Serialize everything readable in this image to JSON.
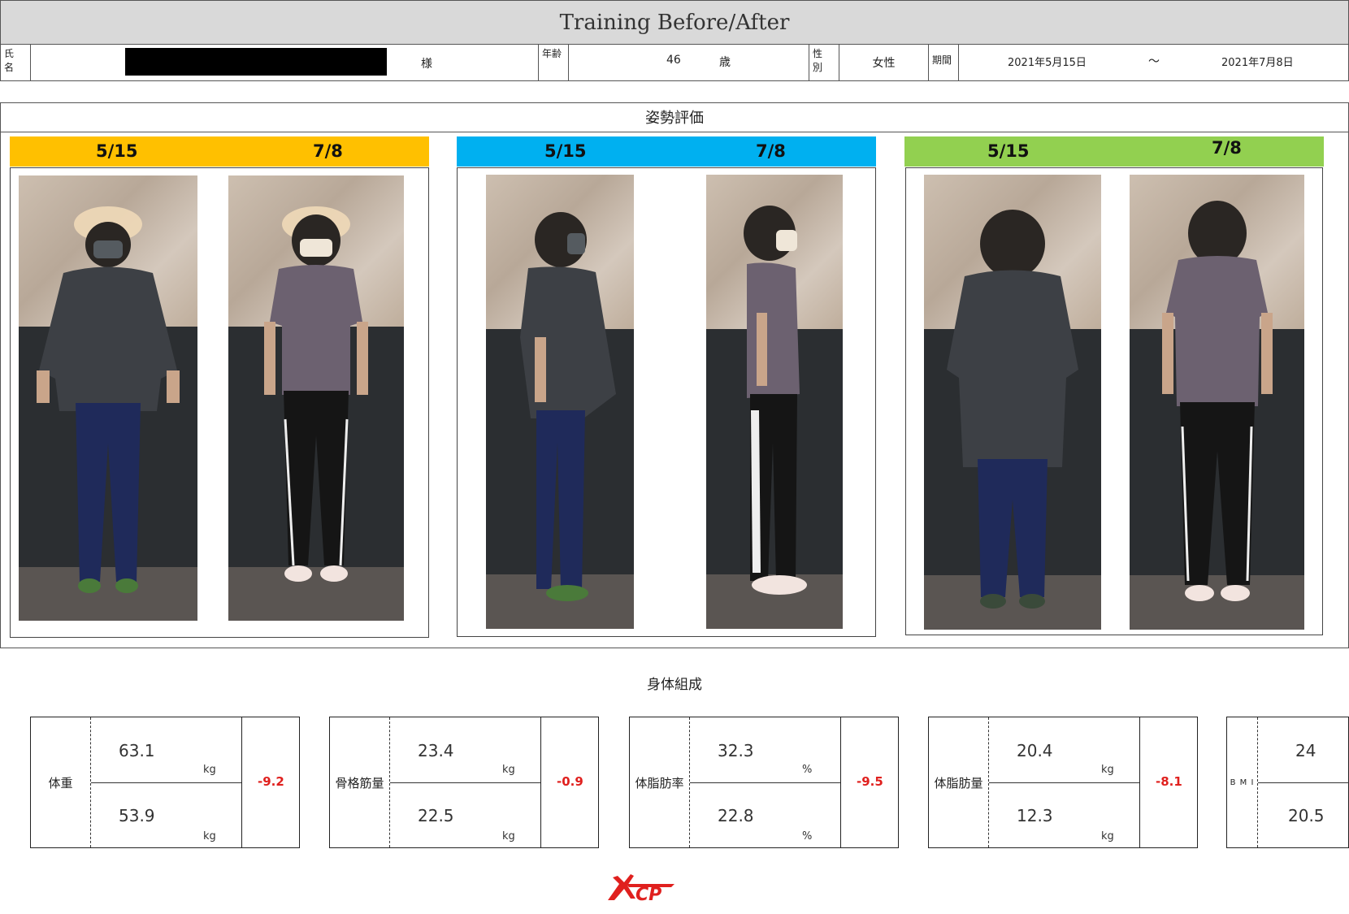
{
  "header": {
    "title": "Training Before/After"
  },
  "info": {
    "name_label": "氏\n名",
    "name_suffix": "様",
    "age_label": "年齢",
    "age_value": "46",
    "age_unit": "歳",
    "sex_label": "性\n別",
    "sex_value": "女性",
    "period_label": "期間",
    "period_start": "2021年5月15日",
    "period_sep": "～",
    "period_end": "2021年7月8日"
  },
  "posture": {
    "title": "姿勢評価",
    "groups": [
      {
        "color": "#ffc000",
        "before": "5/15",
        "after": "7/8"
      },
      {
        "color": "#00b0f0",
        "before": "5/15",
        "after": "7/8"
      },
      {
        "color": "#92d050",
        "before": "5/15",
        "after": "7/8"
      }
    ]
  },
  "body_composition": {
    "title": "身体組成",
    "metrics": [
      {
        "label": "体重",
        "before": "63.1",
        "after": "53.9",
        "unit": "kg",
        "diff": "-9.2"
      },
      {
        "label": "骨格筋量",
        "before": "23.4",
        "after": "22.5",
        "unit": "kg",
        "diff": "-0.9"
      },
      {
        "label": "体脂肪率",
        "before": "32.3",
        "after": "22.8",
        "unit": "%",
        "diff": "-9.5"
      },
      {
        "label": "体脂肪量",
        "before": "20.4",
        "after": "12.3",
        "unit": "kg",
        "diff": "-8.1"
      }
    ],
    "bmi": {
      "label": "B M I",
      "before": "24",
      "after": "20.5"
    }
  },
  "colors": {
    "accent_diff": "#e0201e",
    "logo": "#e0201e"
  },
  "logo": {
    "text": "KCP"
  }
}
